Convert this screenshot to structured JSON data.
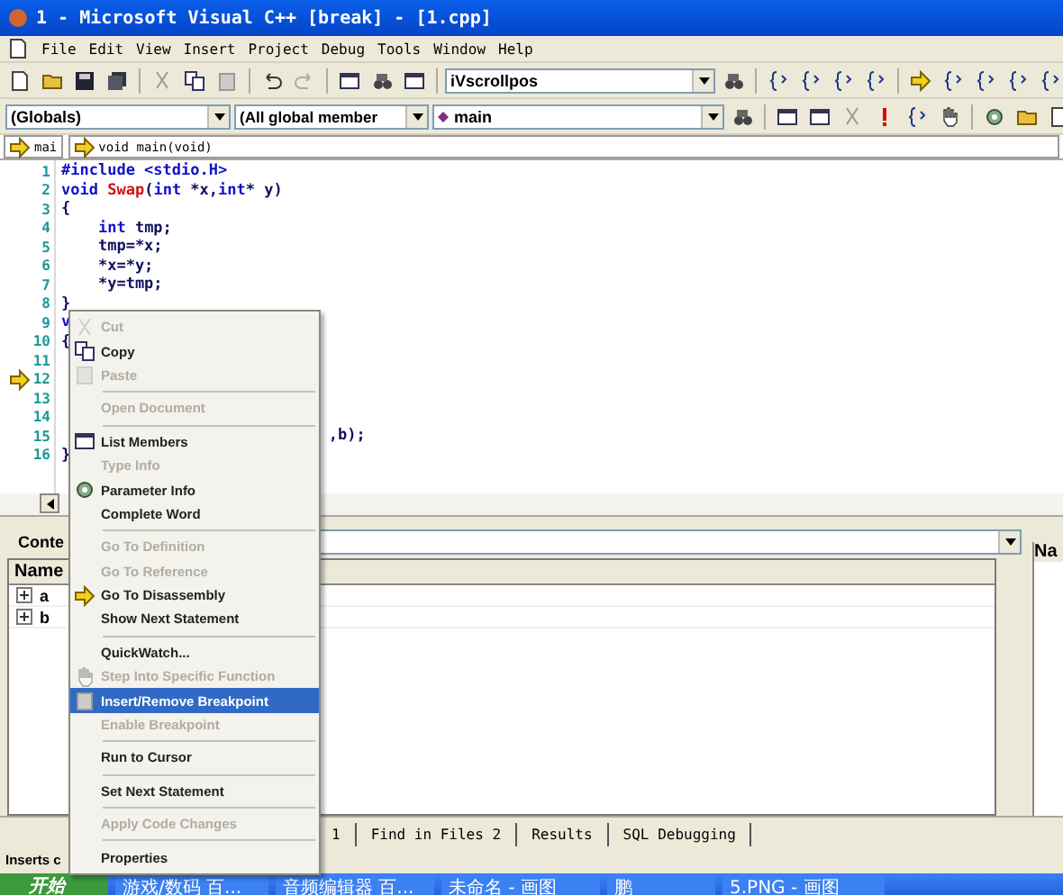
{
  "window": {
    "title": "1 - Microsoft Visual C++ [break] - [1.cpp]"
  },
  "menu_bar": [
    "File",
    "Edit",
    "View",
    "Insert",
    "Project",
    "Debug",
    "Tools",
    "Window",
    "Help"
  ],
  "toolbar": {
    "find_combo": "iVscrollpos"
  },
  "wizard_bar": {
    "class_combo": "(Globals)",
    "filter_combo": "(All global member",
    "member_combo": "main"
  },
  "navigation": {
    "scope": "mai",
    "function": "void main(void)"
  },
  "code": {
    "lines": [
      {
        "number": "1",
        "current": false,
        "tokens": [
          {
            "kind": "keyword",
            "text": "#include <stdio.H>"
          }
        ]
      },
      {
        "number": "2",
        "current": false,
        "tokens": [
          {
            "kind": "keyword",
            "text": "void "
          },
          {
            "kind": "function",
            "text": "Swap"
          },
          {
            "kind": "plain",
            "text": "("
          },
          {
            "kind": "keyword",
            "text": "int"
          },
          {
            "kind": "plain",
            "text": " *x,"
          },
          {
            "kind": "keyword",
            "text": "int"
          },
          {
            "kind": "plain",
            "text": "* y)"
          }
        ]
      },
      {
        "number": "3",
        "current": false,
        "tokens": [
          {
            "kind": "plain",
            "text": "{"
          }
        ]
      },
      {
        "number": "4",
        "current": false,
        "tokens": [
          {
            "kind": "keyword",
            "text": "    int"
          },
          {
            "kind": "plain",
            "text": " tmp;"
          }
        ]
      },
      {
        "number": "5",
        "current": false,
        "tokens": [
          {
            "kind": "plain",
            "text": "    tmp=*x;"
          }
        ]
      },
      {
        "number": "6",
        "current": false,
        "tokens": [
          {
            "kind": "plain",
            "text": "    *x=*y;"
          }
        ]
      },
      {
        "number": "7",
        "current": false,
        "tokens": [
          {
            "kind": "plain",
            "text": "    *y=tmp;"
          }
        ]
      },
      {
        "number": "8",
        "current": false,
        "tokens": [
          {
            "kind": "plain",
            "text": "}"
          }
        ]
      },
      {
        "number": "9",
        "current": false,
        "tokens": [
          {
            "kind": "keyword",
            "text": "v"
          }
        ]
      },
      {
        "number": "10",
        "current": false,
        "tokens": [
          {
            "kind": "plain",
            "text": "{"
          }
        ]
      },
      {
        "number": "11",
        "current": false
      },
      {
        "number": "12",
        "current": true
      },
      {
        "number": "13",
        "current": false
      },
      {
        "number": "14",
        "current": false
      },
      {
        "number": "15",
        "current": false,
        "start_covered": true,
        "tokens": [
          {
            "kind": "plain",
            "text": ",b);"
          }
        ]
      },
      {
        "number": "16",
        "current": false,
        "tokens": [
          {
            "kind": "plain",
            "text": "}"
          }
        ]
      }
    ]
  },
  "variables": {
    "context_label": "Conte",
    "column": "Name",
    "rows": [
      "a",
      "b"
    ]
  },
  "watch": {
    "column": "Na"
  },
  "output_tabs": [
    {
      "label": "1",
      "selected": false
    },
    {
      "label": "Find in Files 2",
      "selected": false
    },
    {
      "label": "Results",
      "selected": false
    },
    {
      "label": "SQL Debugging",
      "selected": false
    }
  ],
  "status_bar": "Inserts c",
  "context_menu": [
    {
      "kind": "item",
      "label": "Cut",
      "disabled": true,
      "selected": false
    },
    {
      "kind": "item",
      "label": "Copy",
      "disabled": false,
      "selected": false
    },
    {
      "kind": "item",
      "label": "Paste",
      "disabled": true,
      "selected": false
    },
    {
      "kind": "separator"
    },
    {
      "kind": "item",
      "label": "Open Document",
      "disabled": true,
      "selected": false
    },
    {
      "kind": "separator"
    },
    {
      "kind": "item",
      "label": "List Members",
      "disabled": false,
      "selected": false
    },
    {
      "kind": "item",
      "label": "Type Info",
      "disabled": true,
      "selected": false
    },
    {
      "kind": "item",
      "label": "Parameter Info",
      "disabled": false,
      "selected": false
    },
    {
      "kind": "item",
      "label": "Complete Word",
      "disabled": false,
      "selected": false
    },
    {
      "kind": "separator"
    },
    {
      "kind": "item",
      "label": "Go To Definition",
      "disabled": true,
      "selected": false
    },
    {
      "kind": "item",
      "label": "Go To Reference",
      "disabled": true,
      "selected": false
    },
    {
      "kind": "item",
      "label": "Go To Disassembly",
      "disabled": false,
      "selected": false
    },
    {
      "kind": "item",
      "label": "Show Next Statement",
      "disabled": false,
      "selected": false
    },
    {
      "kind": "separator"
    },
    {
      "kind": "item",
      "label": "QuickWatch...",
      "disabled": false,
      "selected": false
    },
    {
      "kind": "item",
      "label": "Step Into Specific Function",
      "disabled": true,
      "selected": false
    },
    {
      "kind": "item",
      "label": "Insert/Remove Breakpoint",
      "disabled": false,
      "selected": true
    },
    {
      "kind": "item",
      "label": "Enable Breakpoint",
      "disabled": true,
      "selected": false
    },
    {
      "kind": "separator"
    },
    {
      "kind": "item",
      "label": "Run to Cursor",
      "disabled": false,
      "selected": false
    },
    {
      "kind": "separator"
    },
    {
      "kind": "item",
      "label": "Set Next Statement",
      "disabled": false,
      "selected": false
    },
    {
      "kind": "separator"
    },
    {
      "kind": "item",
      "label": "Apply Code Changes",
      "disabled": true,
      "selected": false
    },
    {
      "kind": "separator"
    },
    {
      "kind": "item",
      "label": "Properties",
      "disabled": false,
      "selected": false
    }
  ],
  "taskbar": {
    "start": "开始",
    "tasks": [
      "游戏/数码 百...",
      "音频编辑器 百...",
      "未命名 - 画图",
      "鹏",
      "5.PNG - 画图"
    ]
  }
}
